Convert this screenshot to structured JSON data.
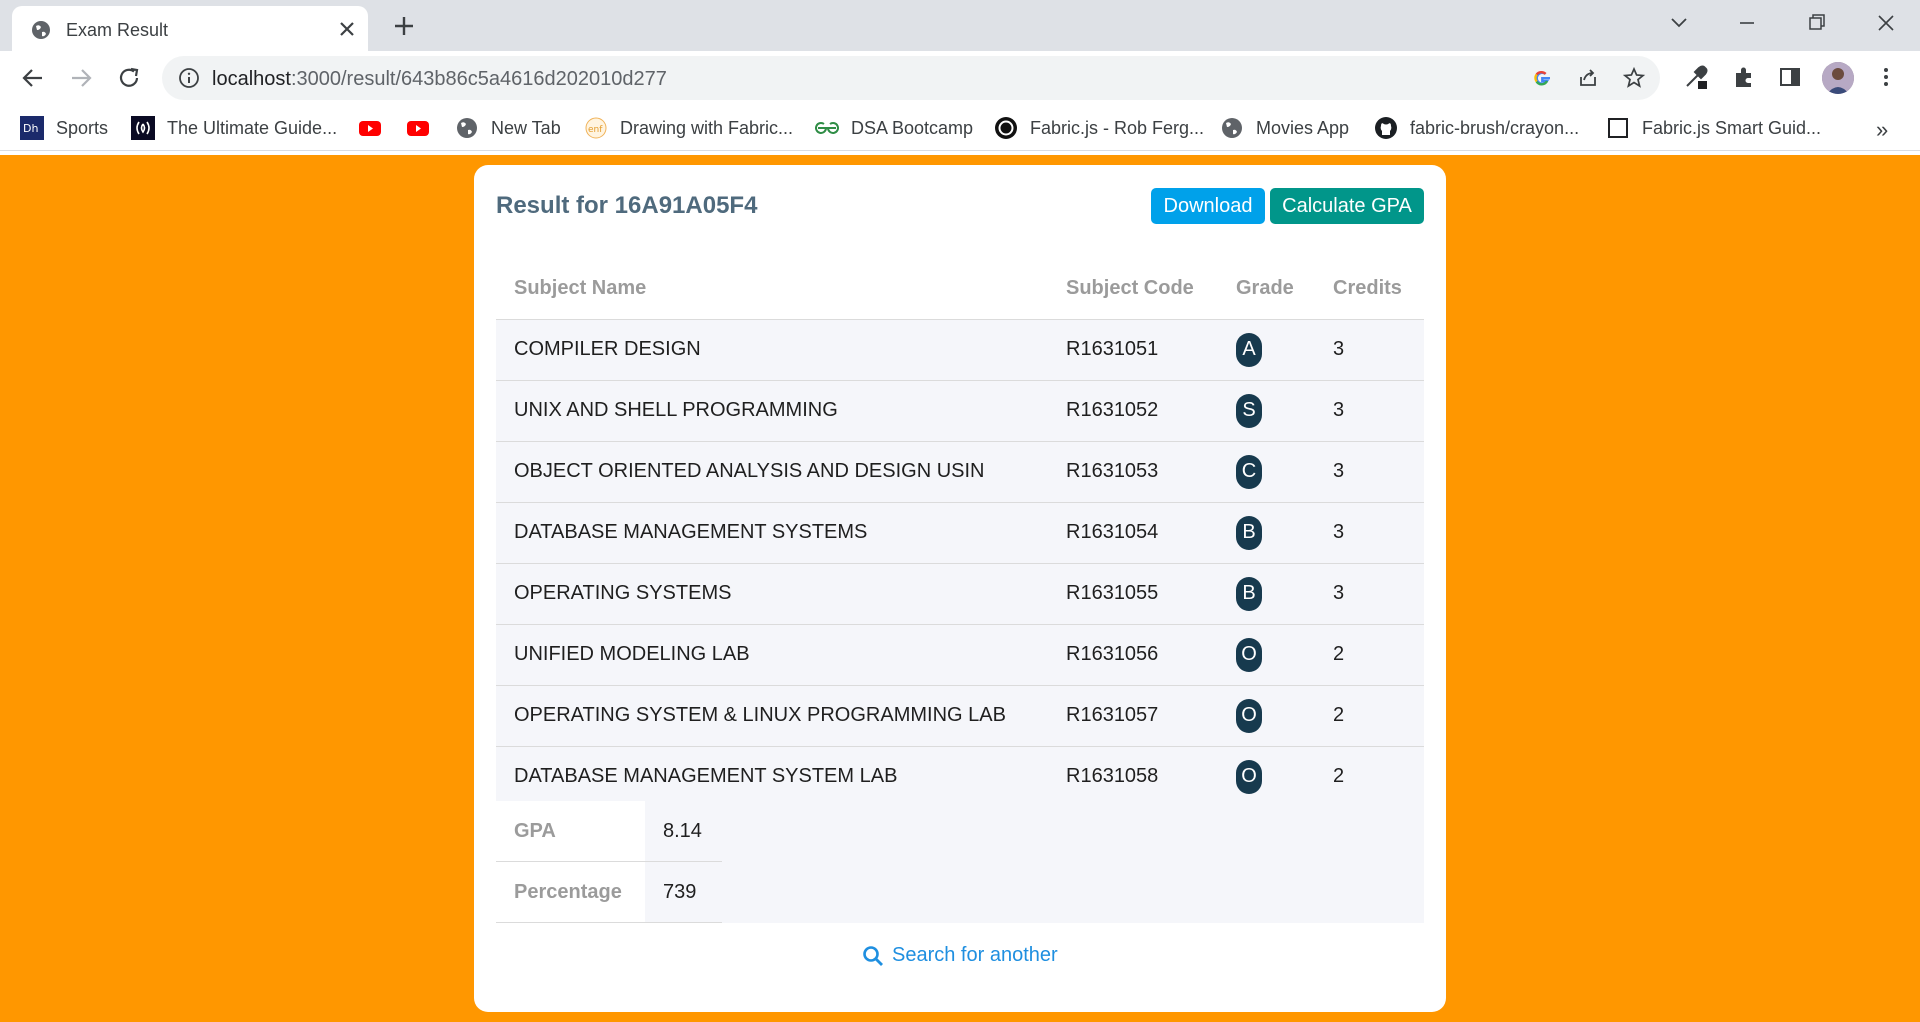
{
  "browser": {
    "tab_title": "Exam Result",
    "url_host": "localhost",
    "url_path": ":3000/result/643b86c5a4616d202010d277",
    "bookmarks": [
      {
        "icon": "dh-icon",
        "label": "Sports"
      },
      {
        "icon": "freecodecamp-icon",
        "label": "The Ultimate Guide..."
      },
      {
        "icon": "youtube-icon",
        "label": ""
      },
      {
        "icon": "youtube-icon",
        "label": ""
      },
      {
        "icon": "globe-icon",
        "label": "New Tab"
      },
      {
        "icon": "enf-icon",
        "label": "Drawing with Fabric..."
      },
      {
        "icon": "gfg-icon",
        "label": "DSA Bootcamp"
      },
      {
        "icon": "circle-logo-icon",
        "label": "Fabric.js - Rob Ferg..."
      },
      {
        "icon": "globe-icon",
        "label": "Movies App"
      },
      {
        "icon": "github-icon",
        "label": "fabric-brush/crayon..."
      },
      {
        "icon": "square-icon",
        "label": "Fabric.js Smart Guid..."
      }
    ],
    "more_bookmarks": "»"
  },
  "page": {
    "title": "Result for 16A91A05F4",
    "download_label": "Download",
    "calc_gpa_label": "Calculate GPA",
    "columns": [
      "Subject Name",
      "Subject Code",
      "Grade",
      "Credits"
    ],
    "subjects": [
      {
        "name": "COMPILER DESIGN",
        "code": "R1631051",
        "grade": "A",
        "credits": "3"
      },
      {
        "name": "UNIX AND SHELL PROGRAMMING",
        "code": "R1631052",
        "grade": "S",
        "credits": "3"
      },
      {
        "name": "OBJECT ORIENTED ANALYSIS AND DESIGN USIN",
        "code": "R1631053",
        "grade": "C",
        "credits": "3"
      },
      {
        "name": "DATABASE MANAGEMENT SYSTEMS",
        "code": "R1631054",
        "grade": "B",
        "credits": "3"
      },
      {
        "name": "OPERATING SYSTEMS",
        "code": "R1631055",
        "grade": "B",
        "credits": "3"
      },
      {
        "name": "UNIFIED MODELING LAB",
        "code": "R1631056",
        "grade": "O",
        "credits": "2"
      },
      {
        "name": "OPERATING SYSTEM & LINUX PROGRAMMING LAB",
        "code": "R1631057",
        "grade": "O",
        "credits": "2"
      },
      {
        "name": "DATABASE MANAGEMENT SYSTEM LAB",
        "code": "R1631058",
        "grade": "O",
        "credits": "2"
      }
    ],
    "gpa_label": "GPA",
    "gpa_value": "8.14",
    "percentage_label": "Percentage",
    "percentage_value": "739",
    "search_label": "Search for another"
  },
  "colors": {
    "page_background": "#ff9700",
    "download_button": "#00a1ea",
    "calc_gpa_button": "#01968a",
    "grade_badge": "#173a4e",
    "link": "#1f8fe0"
  }
}
